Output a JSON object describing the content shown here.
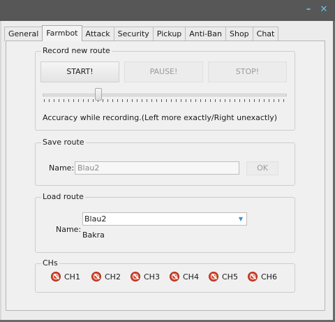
{
  "window": {
    "minimize_glyph": "–",
    "close_glyph": "✕",
    "accent_color": "#5ec8ee"
  },
  "tabs": [
    {
      "label": "General",
      "active": false
    },
    {
      "label": "Farmbot",
      "active": true
    },
    {
      "label": "Attack",
      "active": false
    },
    {
      "label": "Security",
      "active": false
    },
    {
      "label": "Pickup",
      "active": false
    },
    {
      "label": "Anti-Ban",
      "active": false
    },
    {
      "label": "Shop",
      "active": false
    },
    {
      "label": "Chat",
      "active": false
    }
  ],
  "record_route": {
    "title": "Record new route",
    "start_label": "START!",
    "pause_label": "PAUSE!",
    "stop_label": "STOP!",
    "accuracy_slider_value": 0.25,
    "accuracy_text": "Accuracy while recording.(Left more exactly/Right unexactly)"
  },
  "save_route": {
    "title": "Save route",
    "name_label": "Name:",
    "name_value": "Blau2",
    "ok_label": "OK"
  },
  "load_route": {
    "title": "Load route",
    "name_label": "Name:",
    "selected": "Blau2",
    "options_visible": [
      "Blau2",
      "Bakra"
    ]
  },
  "chs": {
    "title": "CHs",
    "status_icon": "forbidden-icon",
    "status_color": "#d7442e",
    "items": [
      "CH1",
      "CH2",
      "CH3",
      "CH4",
      "CH5",
      "CH6"
    ]
  }
}
